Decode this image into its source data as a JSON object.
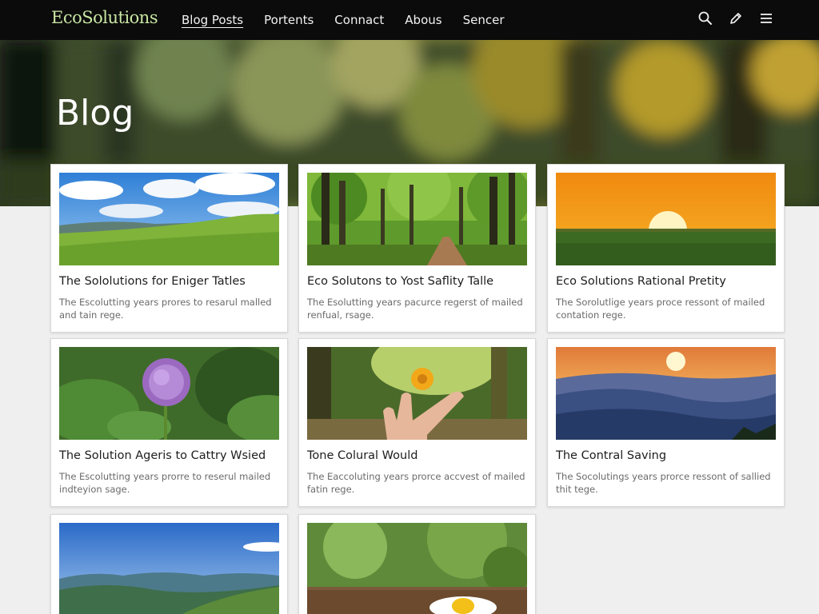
{
  "brand": {
    "name": "EcoSolutions"
  },
  "nav": {
    "links": [
      {
        "label": "Blog Posts",
        "active": true
      },
      {
        "label": "Portents",
        "active": false
      },
      {
        "label": "Connact",
        "active": false
      },
      {
        "label": "Abous",
        "active": false
      },
      {
        "label": "Sencer",
        "active": false
      }
    ],
    "icons": [
      "search-icon",
      "edit-icon",
      "menu-icon"
    ]
  },
  "hero": {
    "title": "Blog"
  },
  "posts": [
    {
      "title": "The Sololutions for Eniger Tatles",
      "description": "The Escolutting years prores to resarul malled and tain rege.",
      "image": "meadow"
    },
    {
      "title": "Eco Solutons to Yost Saflity Talle",
      "description": "The Esolutting years pacurce regerst of mailed renfual, rsage.",
      "image": "forest-path"
    },
    {
      "title": "Eco Solutions Rational Pretity",
      "description": "The Sorolutlige years proce ressont of mailed contation rege.",
      "image": "sunset-field"
    },
    {
      "title": "The Solution Ageris to Cattry Wsied",
      "description": "The Escolutting years prorre to reserul mailed indteyion sage.",
      "image": "purple-flower"
    },
    {
      "title": "Tone Colural Would",
      "description": "The Eaccoluting years prorce accvest of mailed fatin rege.",
      "image": "hand-flower"
    },
    {
      "title": "The Contral Saving",
      "description": "The Socolutings years prorce ressont of sallied thit tege.",
      "image": "mountain-sunset"
    },
    {
      "title": "",
      "description": "",
      "image": "mountain-valley"
    },
    {
      "title": "",
      "description": "",
      "image": "daisy"
    }
  ]
}
